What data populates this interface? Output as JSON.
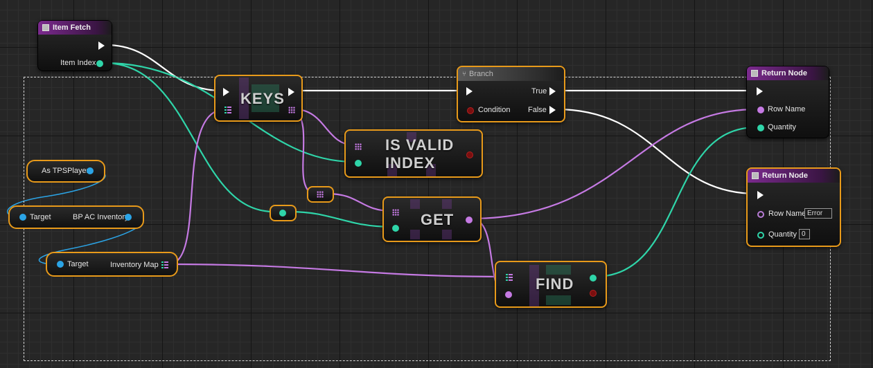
{
  "nodes": {
    "item_fetch": {
      "title": "Item Fetch",
      "item_index_label": "Item Index"
    },
    "keys": {
      "title": "KEYS"
    },
    "branch": {
      "title": "Branch",
      "true_label": "True",
      "false_label": "False",
      "condition_label": "Condition"
    },
    "is_valid_index": {
      "line1": "IS VALID",
      "line2": "INDEX"
    },
    "get": {
      "title": "GET"
    },
    "find": {
      "title": "FIND"
    },
    "return_node_1": {
      "title": "Return Node",
      "row_name_label": "Row Name",
      "quantity_label": "Quantity"
    },
    "return_node_2": {
      "title": "Return Node",
      "row_name_label": "Row Name",
      "row_name_value": "Error",
      "quantity_label": "Quantity",
      "quantity_value": "0"
    },
    "as_tps_player": {
      "label": "As TPSPlayer"
    },
    "bp_ac_inventory": {
      "target_label": "Target",
      "label": "BP AC Inventory"
    },
    "inventory_map": {
      "target_label": "Target",
      "label": "Inventory Map"
    }
  },
  "colors": {
    "exec_wire": "#ffffff",
    "int_wire": "#2fd5a9",
    "name_wire": "#c57ae3",
    "object_wire": "#2ba4e6",
    "selection": "#e89a1a",
    "function_header": "#7b2a8e"
  },
  "icons": {
    "function_header": "function-icon",
    "branch_header": "branch-icon",
    "map_pin": "map-container-icon",
    "set_pin": "set-container-icon"
  }
}
